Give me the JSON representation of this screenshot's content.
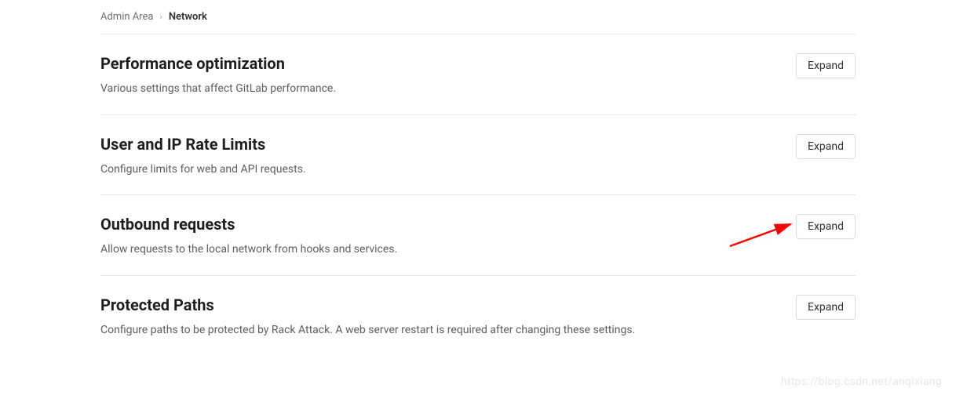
{
  "breadcrumb": {
    "parent": "Admin Area",
    "current": "Network"
  },
  "sections": [
    {
      "title": "Performance optimization",
      "description": "Various settings that affect GitLab performance.",
      "button": "Expand"
    },
    {
      "title": "User and IP Rate Limits",
      "description": "Configure limits for web and API requests.",
      "button": "Expand"
    },
    {
      "title": "Outbound requests",
      "description": "Allow requests to the local network from hooks and services.",
      "button": "Expand"
    },
    {
      "title": "Protected Paths",
      "description": "Configure paths to be protected by Rack Attack. A web server restart is required after changing these settings.",
      "button": "Expand"
    }
  ],
  "watermark": "https://blog.csdn.net/anqixiang"
}
